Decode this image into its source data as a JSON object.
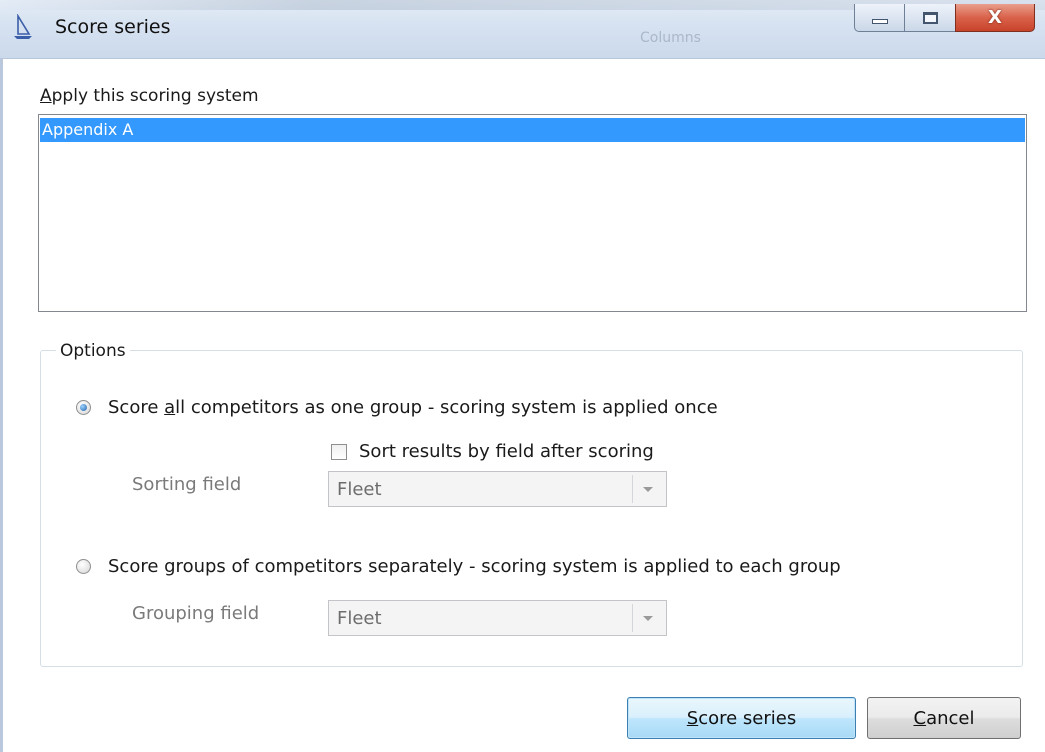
{
  "window": {
    "title": "Score series",
    "close_glyph": "X"
  },
  "background_ghost": {
    "text": "Columns"
  },
  "scoring": {
    "label_prefix": "A",
    "label_rest": "pply this scoring system",
    "list_items": [
      "Appendix A"
    ],
    "selected_index": 0
  },
  "options": {
    "group_label": "Options",
    "radio_all": {
      "label_pre": "Score ",
      "label_accel": "a",
      "label_post": "ll competitors as one group  -  scoring system is applied once",
      "checked": true
    },
    "sort_checkbox": {
      "label": "Sort results by field after scoring",
      "checked": false
    },
    "sorting_field": {
      "label": "Sorting field",
      "value": "Fleet"
    },
    "radio_groups": {
      "label": "Score groups of competitors separately  -  scoring system is applied to each group",
      "checked": false
    },
    "grouping_field": {
      "label": "Grouping field",
      "value": "Fleet"
    }
  },
  "buttons": {
    "score_accel": "S",
    "score_rest": "core series",
    "cancel_accel": "C",
    "cancel_rest": "ancel"
  },
  "colors": {
    "selection": "#3399ff",
    "titlebar": "#d6e2f1",
    "close_button": "#d9624a"
  },
  "icons": {
    "app": "sailboat-icon",
    "minimize": "minimize-icon",
    "maximize": "maximize-icon",
    "close": "close-icon",
    "dropdown": "chevron-down-icon"
  }
}
